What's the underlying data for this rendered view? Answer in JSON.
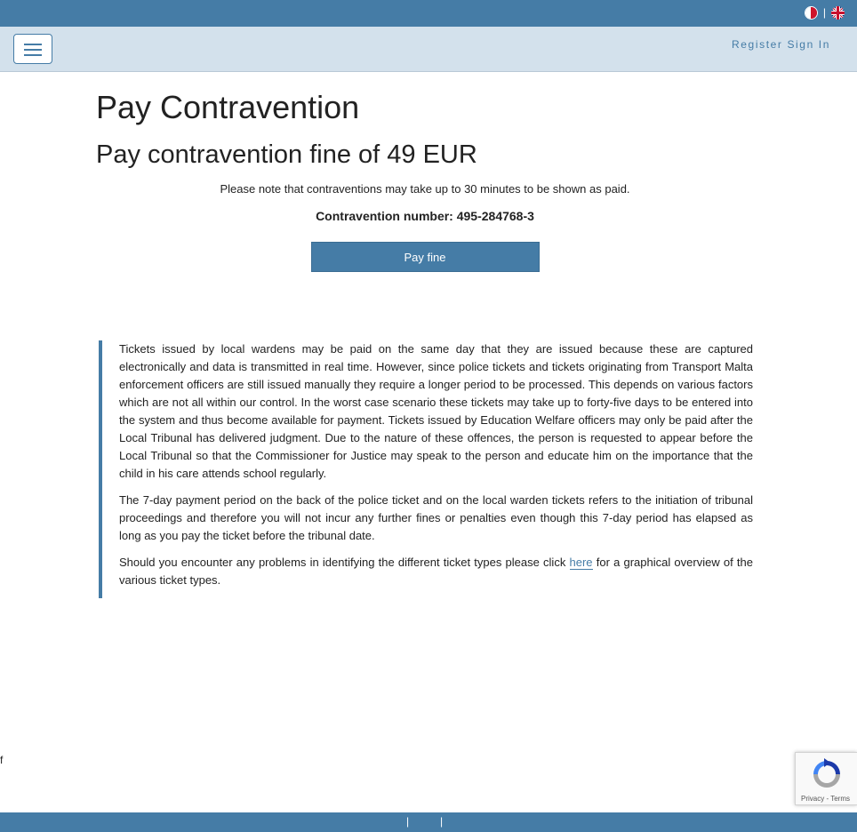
{
  "header": {
    "language_separator": "|",
    "auth_links": [
      "Register",
      "Sign In"
    ]
  },
  "main": {
    "page_title": "Pay Contravention",
    "fine_heading": "Pay contravention fine of 49 EUR",
    "note": "Please note that contraventions may take up to 30 minutes to be shown as paid.",
    "contravention_number": "Contravention number: 495-284768-3",
    "pay_button_label": "Pay fine"
  },
  "info": {
    "paragraph1": "Tickets issued by local wardens may be paid on the same day that they are issued because these are captured electronically and data is transmitted in real time. However, since police tickets and tickets originating from Transport Malta enforcement officers are still issued manually they require a longer period to be processed. This depends on various factors which are not all within our control. In the worst case scenario these tickets may take up to forty-five days to be entered into the system and thus become available for payment. Tickets issued by Education Welfare officers may only be paid after the Local Tribunal has delivered judgment. Due to the nature of these offences, the person is requested to appear before the Local Tribunal so that the Commissioner for Justice may speak to the person and educate him on the importance that the child in his care attends school regularly.",
    "paragraph2": "The 7-day payment period on the back of the police ticket and on the local warden tickets refers to the initiation of tribunal proceedings and therefore you will not incur any further fines or penalties even though this 7-day period has elapsed as long as you pay the ticket before the tribunal date.",
    "paragraph3_before": "Should you encounter any problems in identifying the different ticket types please click ",
    "paragraph3_link": "here",
    "paragraph3_after": " for a graphical overview of the various ticket types."
  },
  "stray_text": "f",
  "recaptcha": {
    "privacy": "Privacy",
    "separator": " - ",
    "terms": "Terms"
  },
  "footer": {
    "separators": [
      "|",
      "|"
    ]
  },
  "colors": {
    "brand_blue": "#457ca6",
    "navbar_bg": "#d3e1ec"
  },
  "icons": [
    "malta-flag-icon",
    "uk-flag-icon",
    "hamburger-icon",
    "recaptcha-logo-icon"
  ]
}
